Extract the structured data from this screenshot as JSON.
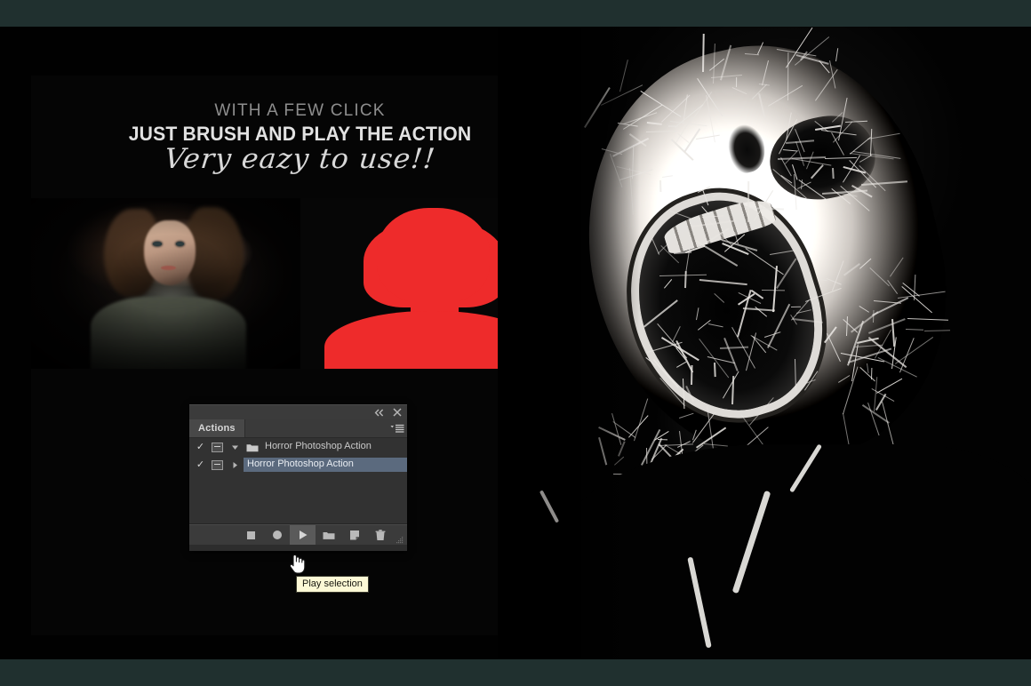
{
  "theme": {
    "frame_color": "#20302f",
    "canvas_color": "#010101",
    "silhouette_red": "#ee2b2b",
    "selection_blue": "#5b6a7e",
    "tooltip_bg": "#fdf9d6",
    "panel_bg": "#323232"
  },
  "promo": {
    "subhead": "WITH A FEW CLICK",
    "headline": "JUST BRUSH AND PLAY THE ACTION",
    "script_line": "Very eazy to use!!"
  },
  "compare": {
    "before_alt": "dark portrait photo of a woman",
    "after_alt": "flat red head and shoulders silhouette"
  },
  "artwork": {
    "alt": "high contrast horror screaming face with scratch texture"
  },
  "actions_panel": {
    "titlebar": {
      "collapse_icon": "double-chevron-left-icon",
      "close_icon": "close-icon"
    },
    "tab_label": "Actions",
    "menu_icon": "panel-menu-icon",
    "columns": {
      "toggle_icon": "check-icon",
      "dialog_icon": "dialog-toggle-icon"
    },
    "rows": [
      {
        "checked": "✓",
        "expanded": true,
        "twisty": "▼",
        "icon": "folder-icon",
        "label": "Horror Photoshop Action",
        "selected": false,
        "type": "set"
      },
      {
        "checked": "✓",
        "expanded": false,
        "twisty": "▶",
        "icon": "none",
        "label": "Horror Photoshop Action",
        "selected": true,
        "type": "action"
      }
    ],
    "toolbar": [
      {
        "name": "stop-playing-button",
        "label": "Stop playing/recording",
        "icon": "stop-square-icon",
        "active": false
      },
      {
        "name": "begin-recording-button",
        "label": "Begin recording",
        "icon": "record-circle-icon",
        "active": false
      },
      {
        "name": "play-selection-button",
        "label": "Play selection",
        "icon": "play-triangle-icon",
        "active": true
      },
      {
        "name": "create-new-set-button",
        "label": "Create new set",
        "icon": "folder-icon",
        "active": false
      },
      {
        "name": "create-new-action-button",
        "label": "Create new action",
        "icon": "new-page-icon",
        "active": false
      },
      {
        "name": "delete-button",
        "label": "Delete",
        "icon": "trash-icon",
        "active": false
      },
      {
        "name": "resize-grip",
        "label": "Resize panel",
        "icon": "grip-icon",
        "active": false
      }
    ]
  },
  "tooltip": {
    "text": "Play selection"
  },
  "cursor": {
    "kind": "pointing-hand-cursor"
  }
}
